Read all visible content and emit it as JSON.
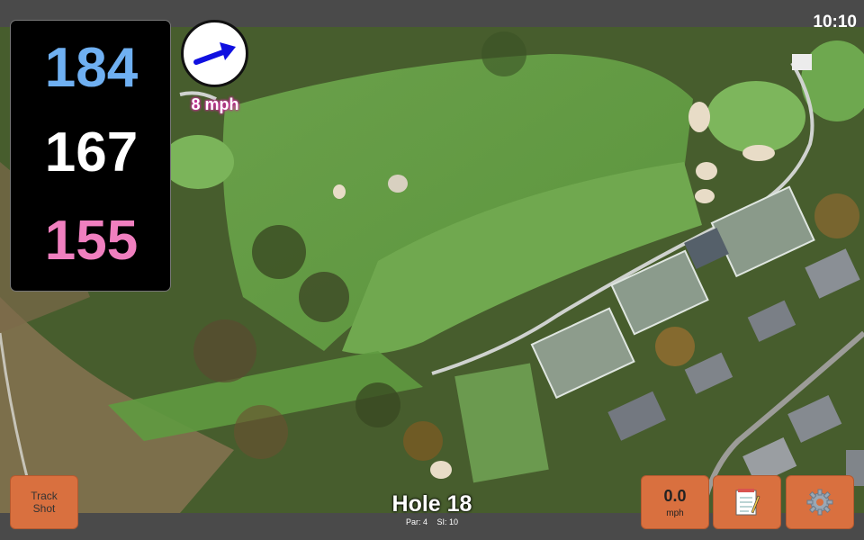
{
  "status": {
    "clock": "10:10"
  },
  "distances": {
    "back": "184",
    "middle": "167",
    "front": "155"
  },
  "wind": {
    "speed_label": "8 mph",
    "direction": "arrow-icon"
  },
  "buttons": {
    "track_shot_line1": "Track",
    "track_shot_line2": "Shot",
    "speed_value": "0.0",
    "speed_unit": "mph",
    "notes_icon": "notepad-icon",
    "settings_icon": "gear-icon"
  },
  "hole": {
    "title": "Hole 18",
    "par": "Par: 4",
    "si": "SI: 10"
  },
  "colors": {
    "back": "#6fb0f2",
    "middle": "#ffffff",
    "front": "#f07fbf",
    "button": "#d9703f",
    "wind_arrow": "#1010e0",
    "wind_glow": "#d02ea0"
  }
}
